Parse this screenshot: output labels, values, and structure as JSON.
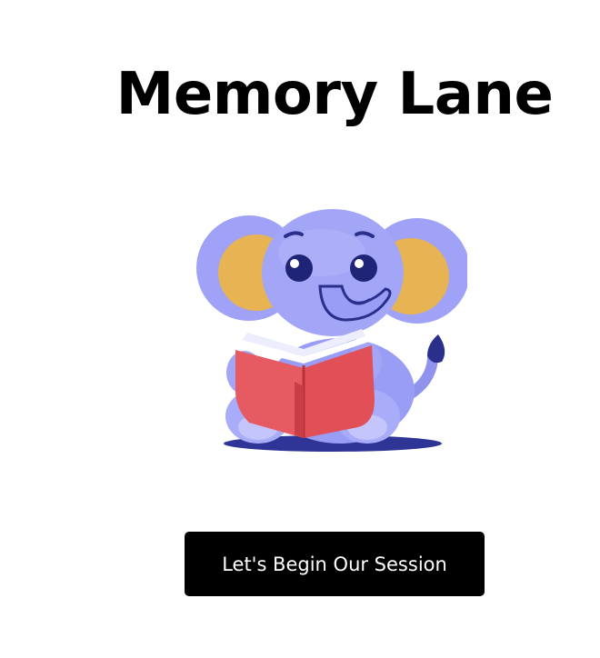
{
  "header": {
    "title": "Memory Lane"
  },
  "mascot": {
    "icon": "elephant-reading-book-icon"
  },
  "actions": {
    "start_label": "Let's Begin Our Session"
  },
  "colors": {
    "background": "#ffffff",
    "title_text": "#000000",
    "button_bg": "#000000",
    "button_text": "#ffffff",
    "elephant_body": "#9a9df5",
    "elephant_ear_inner": "#e8b352",
    "book_cover": "#e65b62",
    "shadow": "#2e3596"
  }
}
